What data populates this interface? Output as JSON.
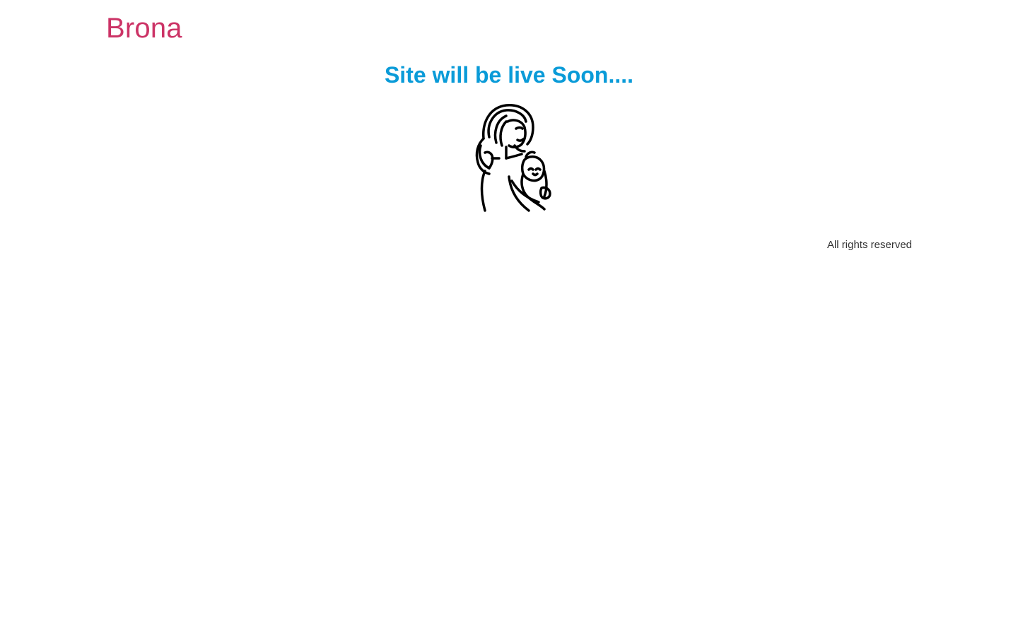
{
  "header": {
    "logo_text": "Brona"
  },
  "main": {
    "headline": "Site will be live Soon...."
  },
  "illustration": {
    "icon": "mother-and-child-icon"
  },
  "footer": {
    "copyright": "All rights reserved"
  },
  "colors": {
    "logo": "#cc3366",
    "headline": "#0a9bd8",
    "footer_text": "#333333",
    "background": "#ffffff",
    "illustration_stroke": "#000000"
  }
}
